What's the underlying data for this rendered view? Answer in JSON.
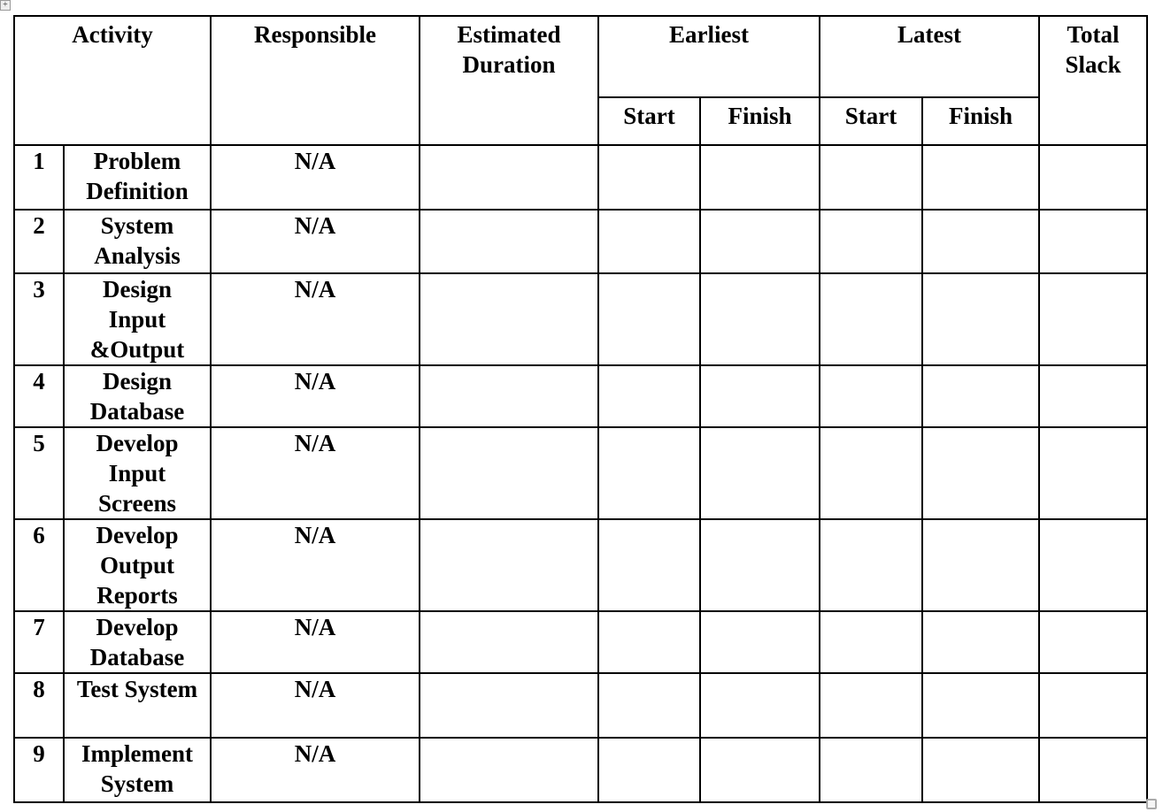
{
  "header": {
    "activity": "Activity",
    "responsible": "Responsible",
    "estimated_duration": "Estimated Duration",
    "earliest": "Earliest",
    "latest": "Latest",
    "total_slack": "Total Slack",
    "earliest_start": "Start",
    "earliest_finish": "Finish",
    "latest_start": "Start",
    "latest_finish": "Finish"
  },
  "rows": [
    {
      "num": "1",
      "activity": "Problem Definition",
      "responsible": "N/A"
    },
    {
      "num": "2",
      "activity": "System Analysis",
      "responsible": "N/A"
    },
    {
      "num": "3",
      "activity": "Design Input &Output",
      "responsible": "N/A"
    },
    {
      "num": "4",
      "activity": "Design Database",
      "responsible": "N/A"
    },
    {
      "num": "5",
      "activity": "Develop Input Screens",
      "responsible": "N/A"
    },
    {
      "num": "6",
      "activity": "Develop Output Reports",
      "responsible": "N/A"
    },
    {
      "num": "7",
      "activity": "Develop Database",
      "responsible": "N/A"
    },
    {
      "num": "8",
      "activity": "Test System",
      "responsible": "N/A"
    },
    {
      "num": "9",
      "activity": "Implement System",
      "responsible": "N/A"
    }
  ]
}
